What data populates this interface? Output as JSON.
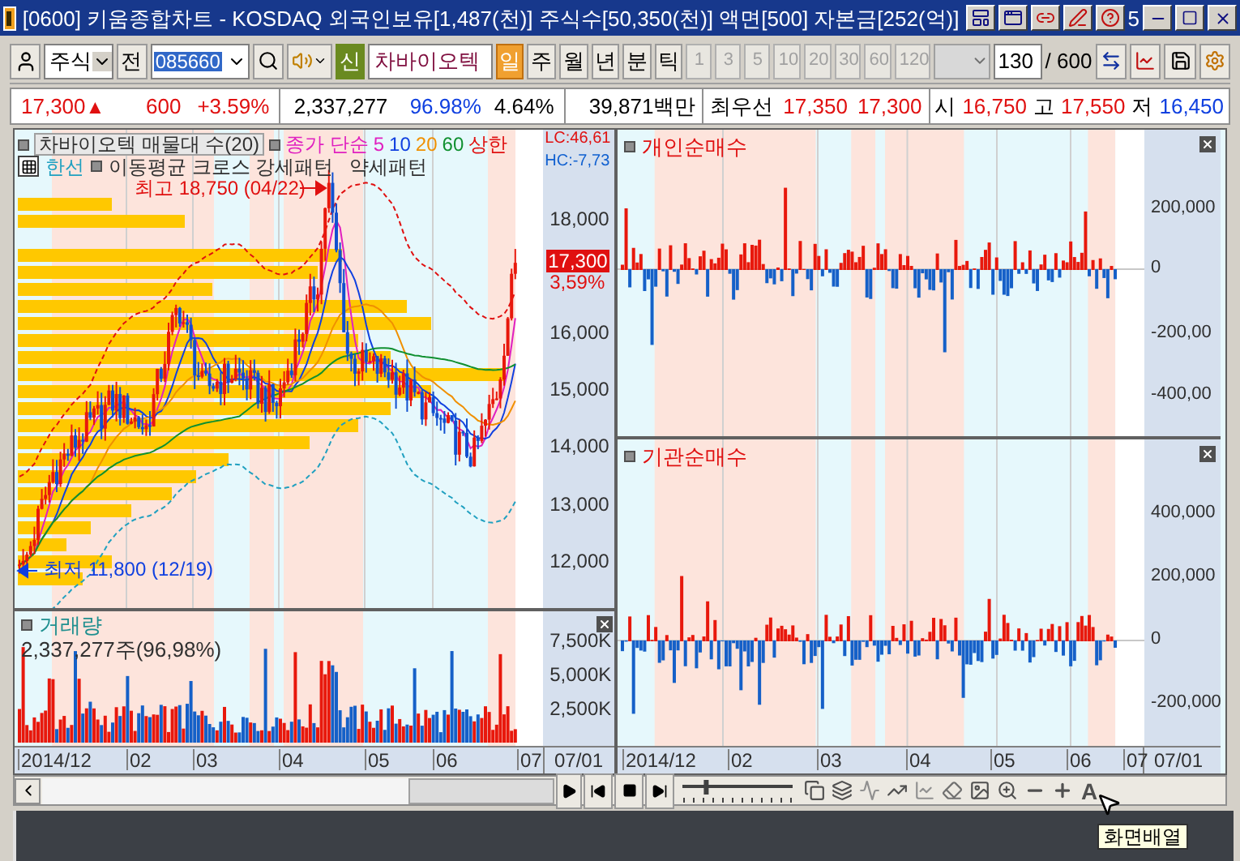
{
  "window": {
    "title": "[0600] 키움종합차트 - KOSDAQ 외국인보유[1,487(천)] 주식수[50,350(천)] 액면[500] 자본금[252(억)]",
    "title_fragment": "5"
  },
  "toolbar": {
    "market": "주식",
    "prev_button": "전",
    "code": "085660",
    "new_badge": "신",
    "stock_name": "차바이오텍",
    "periods": [
      {
        "label": "일",
        "selected": true
      },
      {
        "label": "주",
        "selected": false
      },
      {
        "label": "월",
        "selected": false
      },
      {
        "label": "년",
        "selected": false
      },
      {
        "label": "분",
        "selected": false
      },
      {
        "label": "틱",
        "selected": false
      }
    ],
    "intervals": [
      {
        "label": "1",
        "disabled": true
      },
      {
        "label": "3",
        "disabled": true
      },
      {
        "label": "5",
        "disabled": true
      },
      {
        "label": "10",
        "disabled": true
      },
      {
        "label": "20",
        "disabled": true
      },
      {
        "label": "30",
        "disabled": true
      },
      {
        "label": "60",
        "disabled": true
      },
      {
        "label": "120",
        "disabled": true
      }
    ],
    "count": "130",
    "total": "/ 600"
  },
  "quote": {
    "price": "17,300",
    "arrow": "▲",
    "change": "600",
    "change_rate": "+3.59%",
    "volume": "2,337,277",
    "volume_ratio": "96.98%",
    "turnover": "4.64%",
    "amount": "39,871백만",
    "best_label": "최우선",
    "ask": "17,350",
    "bid": "17,300",
    "open_label": "시",
    "open": "16,750",
    "high_label": "고",
    "high": "17,550",
    "low_label": "저",
    "low": "16,450"
  },
  "price_chart": {
    "legend_title": "차바이오텍 매물대 수(20)",
    "ma_legend": [
      {
        "label": "종가 단순",
        "color": "#e020c0"
      },
      {
        "label": "5",
        "color": "#e020c0"
      },
      {
        "label": "10",
        "color": "#1040e0"
      },
      {
        "label": "20",
        "color": "#f09000"
      },
      {
        "label": "60",
        "color": "#109030"
      },
      {
        "label": "상한",
        "color": "#e01010"
      }
    ],
    "lower_band_label": "한선",
    "pattern_labels": [
      "이동평균 크로스 강세패턴",
      "약세패턴"
    ],
    "high_note": "최고 18,750 (04/22)",
    "low_note": "최저 11,800 (12/19)",
    "lc": "LC:46,61",
    "hc": "HC:-7,73",
    "ticks": [
      "18,000",
      "16,000",
      "15,000",
      "14,000",
      "13,000",
      "12,000"
    ],
    "current_price": "17,300",
    "current_rate": "3,59%"
  },
  "volume": {
    "title": "거래량",
    "summary": "2,337,277주(96,98%)",
    "ticks": [
      "7,500K",
      "5,000K",
      "2,500K"
    ]
  },
  "left_dates": [
    "2014/12",
    "02",
    "03",
    "04",
    "05",
    "06",
    "07"
  ],
  "left_axis_date": "07/01",
  "individual": {
    "title": "개인순매수",
    "ticks": [
      "200,000",
      "0",
      "-200,00",
      "-400,00"
    ]
  },
  "institution": {
    "title": "기관순매수",
    "ticks": [
      "400,000",
      "200,000",
      "0",
      "-200,000"
    ]
  },
  "right_dates": [
    "2014/12",
    "02",
    "03",
    "04",
    "05",
    "06",
    "07"
  ],
  "right_axis_date": "07/01",
  "bottom_bar": {
    "font_button": "A",
    "zoom_slider": {
      "level": 0.2
    }
  },
  "tooltip": "화면배열"
}
